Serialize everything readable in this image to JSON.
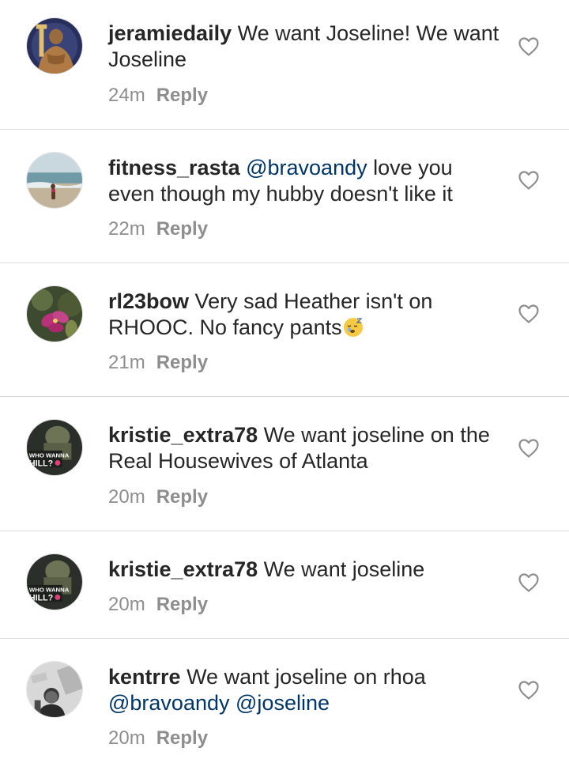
{
  "comments": [
    {
      "avatar_icon": "avatar-muscular-man-icon",
      "username": "jeramiedaily",
      "text": "We want Joseline! We want Joseline",
      "time": "24m",
      "reply_label": "Reply"
    },
    {
      "avatar_icon": "avatar-beach-photo-icon",
      "username": "fitness_rasta",
      "mention": "@bravoandy",
      "text": " love you even though my hubby doesn't like it",
      "time": "22m",
      "reply_label": "Reply"
    },
    {
      "avatar_icon": "avatar-flower-photo-icon",
      "username": "rl23bow",
      "text": "Very sad Heather isn't on RHOOC.  No fancy pants",
      "emoji": "sleepy-face-emoji",
      "time": "21m",
      "reply_label": "Reply"
    },
    {
      "avatar_icon": "avatar-who-wanna-chill-icon",
      "username": "kristie_extra78",
      "text": "We want joseline on the Real Housewives of Atlanta",
      "time": "20m",
      "reply_label": "Reply"
    },
    {
      "avatar_icon": "avatar-who-wanna-chill-icon",
      "username": "kristie_extra78",
      "text": "We want joseline",
      "time": "20m",
      "reply_label": "Reply"
    },
    {
      "avatar_icon": "avatar-man-selfie-icon",
      "username": "kentrre",
      "text": "We want joseline on rhoa ",
      "mention": "@bravoandy",
      "mention2": "@joseline",
      "time": "20m",
      "reply_label": "Reply"
    }
  ],
  "avatar_caption": "WHO WANNA HILL?",
  "like_icon": "heart-outline-icon",
  "colors": {
    "username": "#262626",
    "mention": "#003569",
    "meta": "#8e8e8e",
    "divider": "#dbdbdb"
  }
}
